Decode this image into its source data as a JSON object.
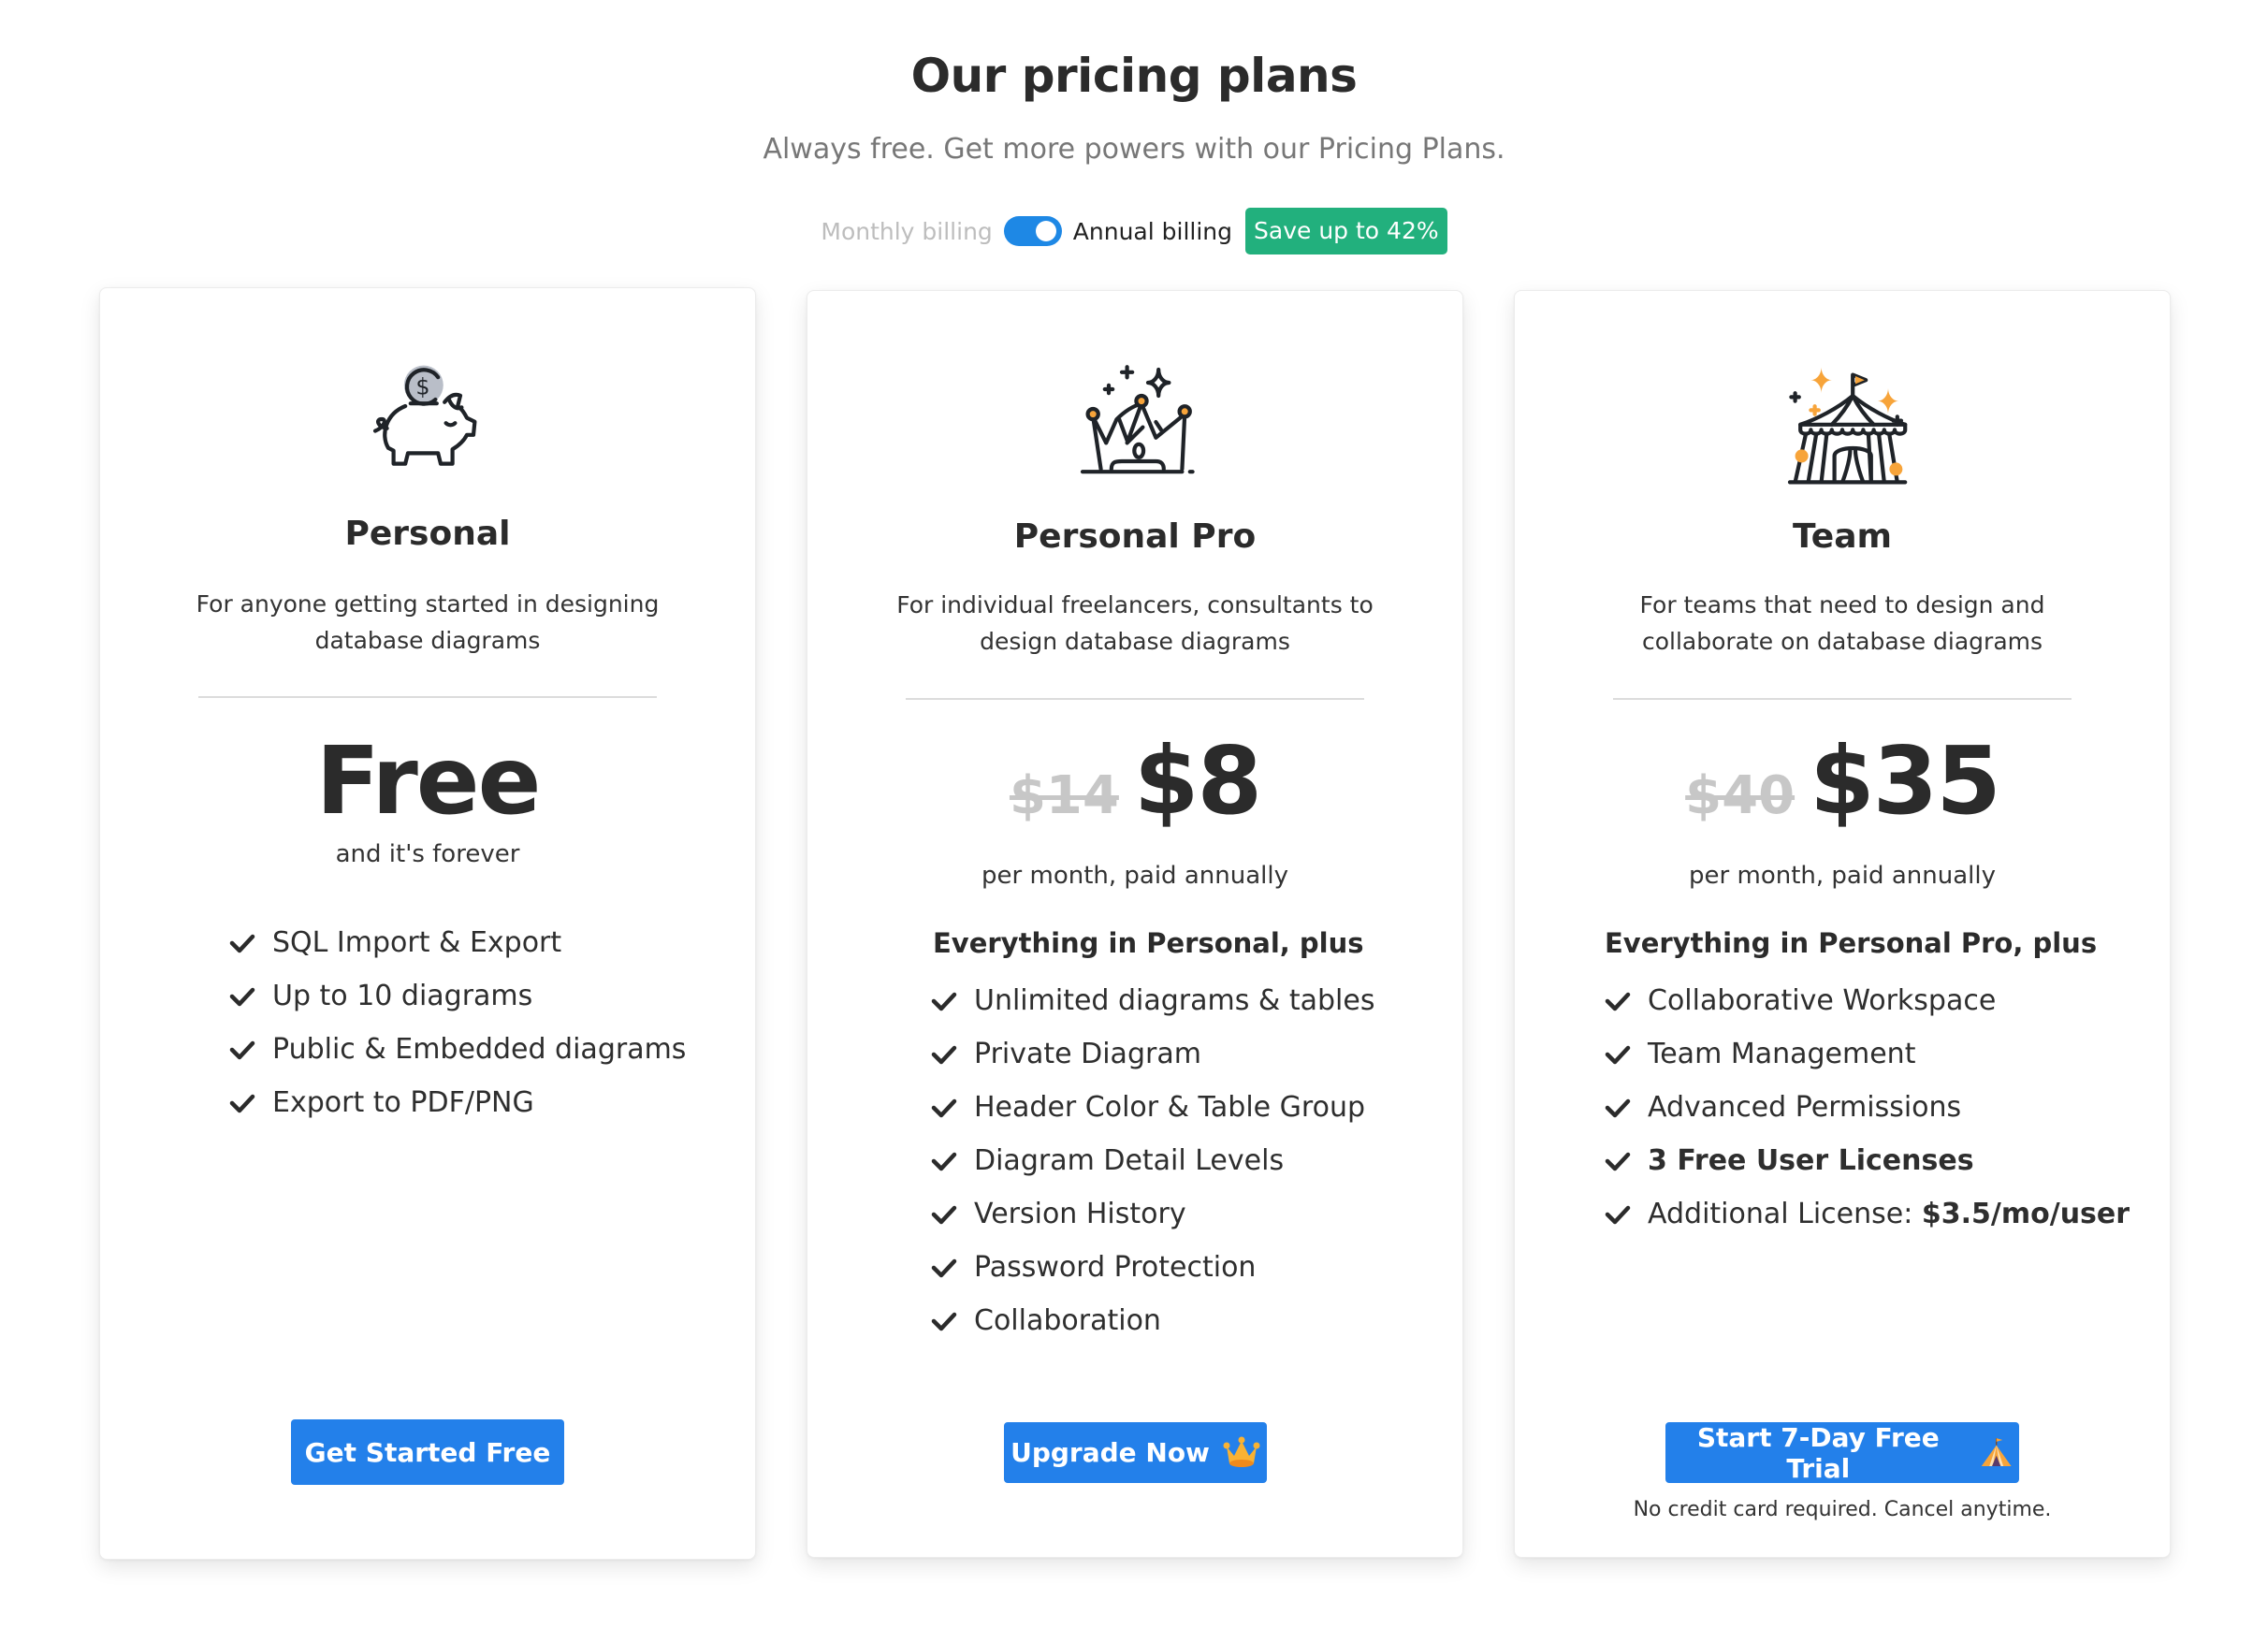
{
  "header": {
    "title": "Our pricing plans",
    "subtitle": "Always free. Get more powers with our Pricing Plans."
  },
  "billing": {
    "monthly_label": "Monthly billing",
    "annual_label": "Annual billing",
    "selected": "annual",
    "save_badge": "Save up to 42%",
    "colors": {
      "toggle": "#1e88e5",
      "badge": "#22b07d"
    }
  },
  "plans": [
    {
      "name": "Personal",
      "icon": "piggy-bank-icon",
      "description": "For anyone getting started in designing database diagrams",
      "price": "Free",
      "price_note": "and it's forever",
      "features_heading": "",
      "features": [
        {
          "text": "SQL Import & Export"
        },
        {
          "text": "Up to 10 diagrams"
        },
        {
          "text": "Public & Embedded diagrams"
        },
        {
          "text": "Export to PDF/PNG"
        }
      ],
      "button": {
        "label": "Get Started Free",
        "icon": ""
      },
      "button_note": ""
    },
    {
      "name": "Personal Pro",
      "icon": "crown-icon",
      "description": "For individual freelancers, consultants to design database diagrams",
      "old_price": "$14",
      "price": "$8",
      "price_note": "per month, paid annually",
      "features_heading": "Everything in Personal, plus",
      "features": [
        {
          "text": "Unlimited diagrams & tables"
        },
        {
          "text": "Private Diagram"
        },
        {
          "text": "Header Color & Table Group"
        },
        {
          "text": "Diagram Detail Levels"
        },
        {
          "text": "Version History"
        },
        {
          "text": "Password Protection"
        },
        {
          "text": "Collaboration"
        }
      ],
      "button": {
        "label": "Upgrade Now",
        "icon": "crown-emoji-icon"
      },
      "button_note": ""
    },
    {
      "name": "Team",
      "icon": "circus-tent-icon",
      "description": "For teams that need to design and collaborate on database diagrams",
      "old_price": "$40",
      "price": "$35",
      "price_note": "per month, paid annually",
      "features_heading": "Everything in Personal Pro, plus",
      "features": [
        {
          "text": "Collaborative Workspace"
        },
        {
          "text": "Team Management"
        },
        {
          "text": "Advanced Permissions"
        },
        {
          "text": "3 Free User Licenses",
          "bold": true
        },
        {
          "text": "Additional License: ",
          "bold_suffix": "$3.5/mo/user"
        }
      ],
      "button": {
        "label": "Start 7-Day Free Trial",
        "icon": "circus-tent-emoji-icon"
      },
      "button_note": "No credit card required. Cancel anytime."
    }
  ],
  "colors": {
    "primary_button": "#2380ea",
    "accent_orange": "#f7a43a",
    "text": "#2b2b2b"
  }
}
